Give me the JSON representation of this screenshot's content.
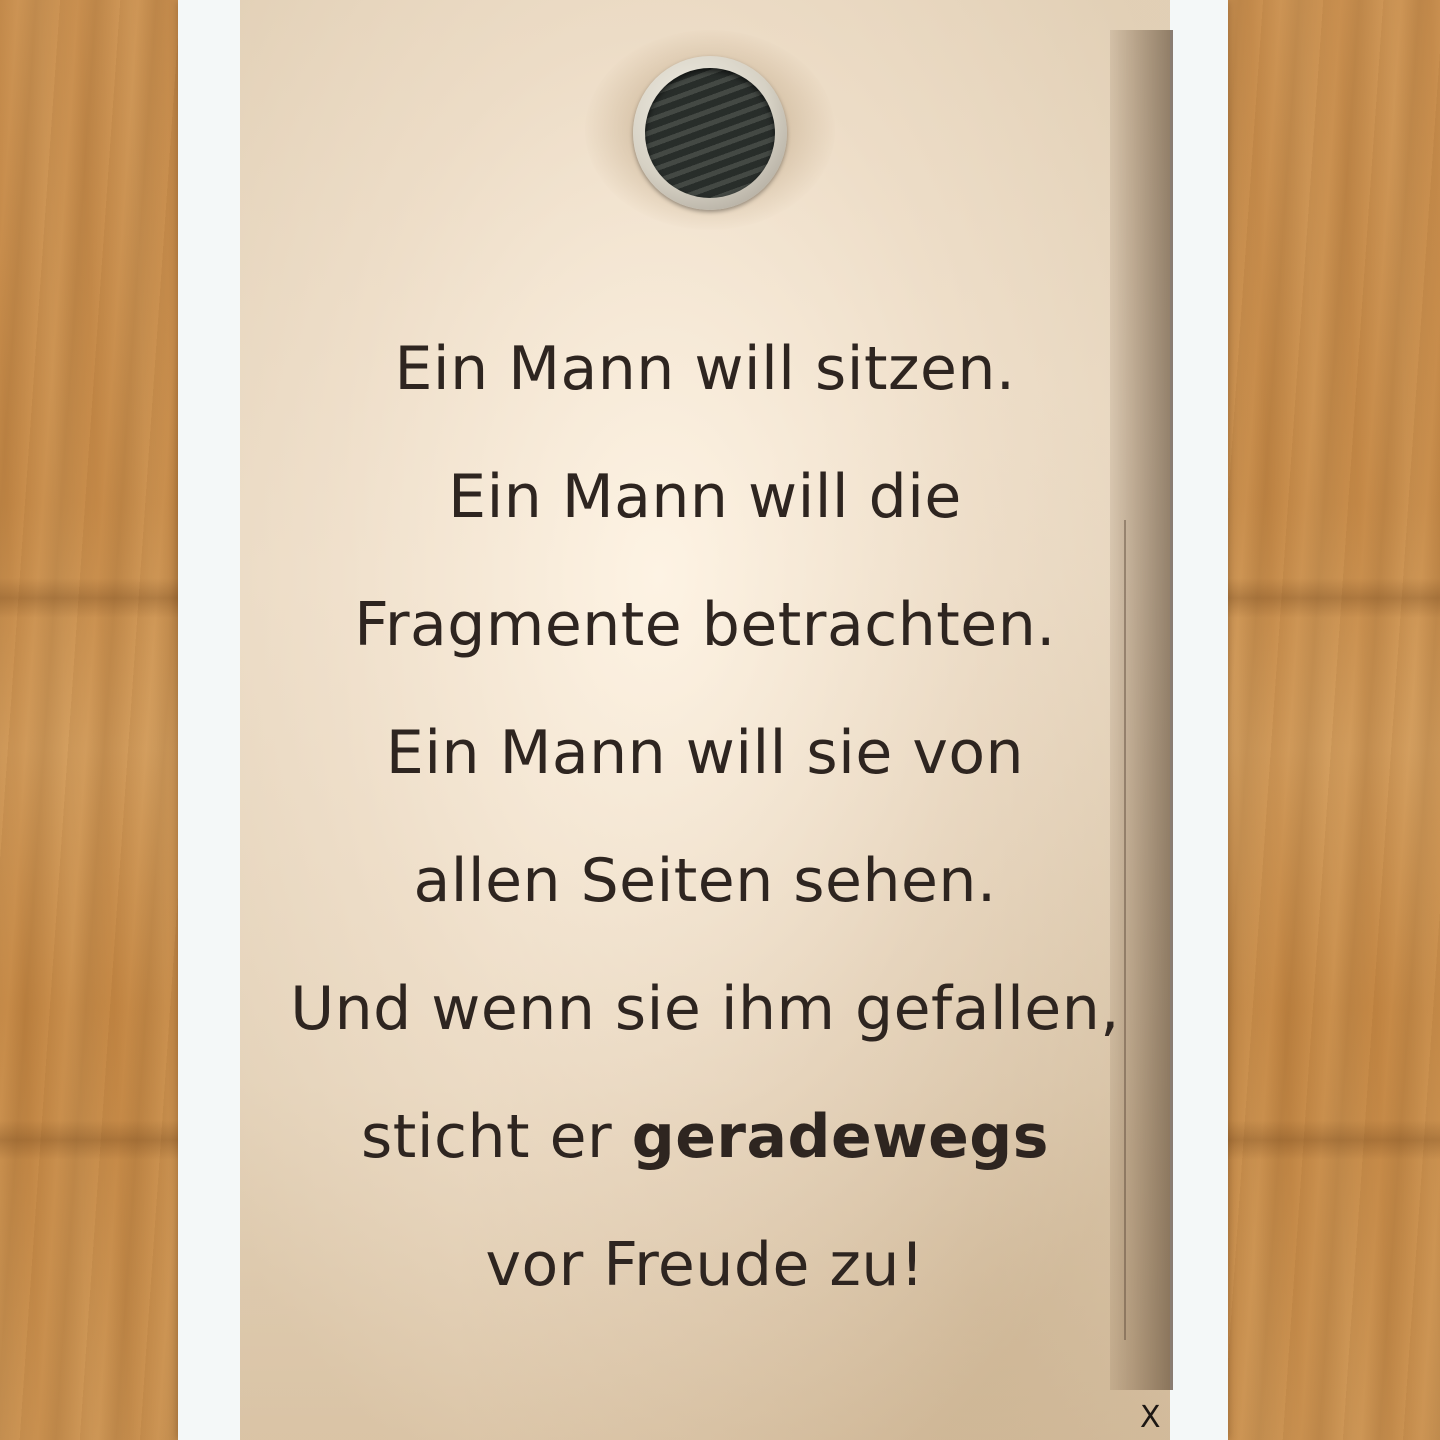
{
  "card": {
    "poem_lines": [
      "Ein Mann will sitzen.",
      "Ein Mann will die",
      "Fragmente betrachten.",
      "Ein Mann will sie von",
      "allen Seiten sehen.",
      "Und wenn sie ihm gefallen,",
      "sticht er",
      "geradewegs",
      "vor Freude zu!"
    ],
    "corner_mark": "X"
  }
}
